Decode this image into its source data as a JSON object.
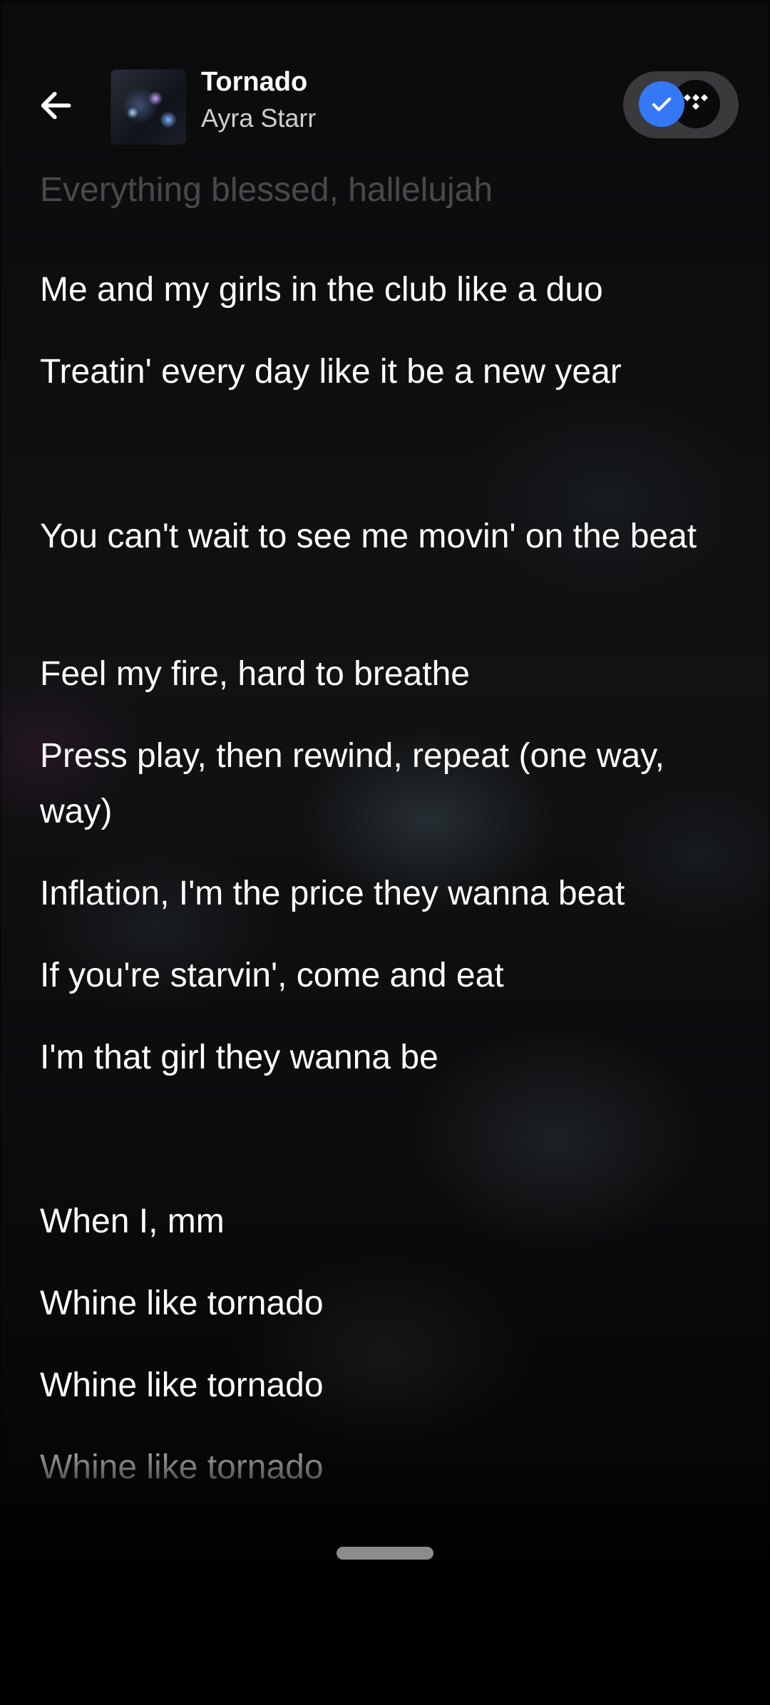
{
  "header": {
    "back_icon": "arrow-left-icon",
    "title": "Tornado",
    "artist": "Ayra Starr",
    "toggle": {
      "check_icon": "check-icon",
      "service_icon": "tidal-logo-icon",
      "accent_color": "#3478f6"
    }
  },
  "lyrics": {
    "lines": [
      "Everything blessed, hallelujah",
      "Me and my girls in the club like a duo",
      "Treatin' every day like it be a new year",
      "You can't wait to see me movin' on the beat",
      "Feel my fire, hard to breathe",
      "Press play, then rewind, repeat (one way, way)",
      "Inflation, I'm the price they wanna beat",
      "If you're starvin', come and eat",
      "I'm that girl they wanna be",
      "When I, mm",
      "Whine like tornado",
      "Whine like tornado",
      "Whine like tornado"
    ]
  }
}
